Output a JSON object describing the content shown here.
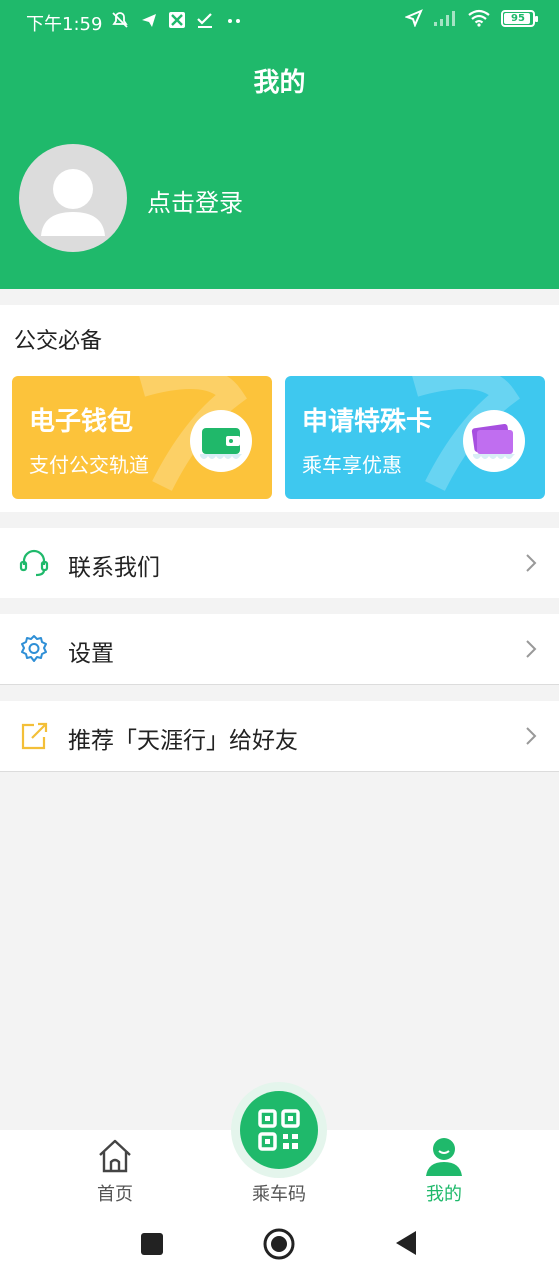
{
  "status_bar": {
    "time": "下午1:59",
    "battery": "95",
    "icons": [
      "mute-icon",
      "telegram-icon",
      "sync-icon",
      "check-icon",
      "more-icon",
      "location-icon",
      "signal-icon",
      "wifi-icon",
      "battery-icon"
    ]
  },
  "header": {
    "title": "我的",
    "login_prompt": "点击登录",
    "color": "#1fb96b"
  },
  "essentials": {
    "title": "公交必备",
    "cards": [
      {
        "title": "电子钱包",
        "subtitle": "支付公交轨道",
        "icon": "wallet-icon",
        "color": "#fcc33b"
      },
      {
        "title": "申请特殊卡",
        "subtitle": "乘车享优惠",
        "icon": "card-icon",
        "color": "#3ec8ef"
      }
    ]
  },
  "menu": [
    {
      "label": "联系我们",
      "icon": "headset-icon"
    },
    {
      "label": "设置",
      "icon": "gear-icon"
    },
    {
      "label": "推荐「天涯行」给好友",
      "icon": "share-icon"
    }
  ],
  "tabbar": {
    "tabs": [
      {
        "label": "首页",
        "icon": "home-icon"
      },
      {
        "label": "乘车码",
        "icon": "qr-code-icon"
      },
      {
        "label": "我的",
        "icon": "user-icon",
        "active": true
      }
    ]
  },
  "system_nav": [
    "recent-apps-icon",
    "home-circle-icon",
    "back-icon"
  ]
}
